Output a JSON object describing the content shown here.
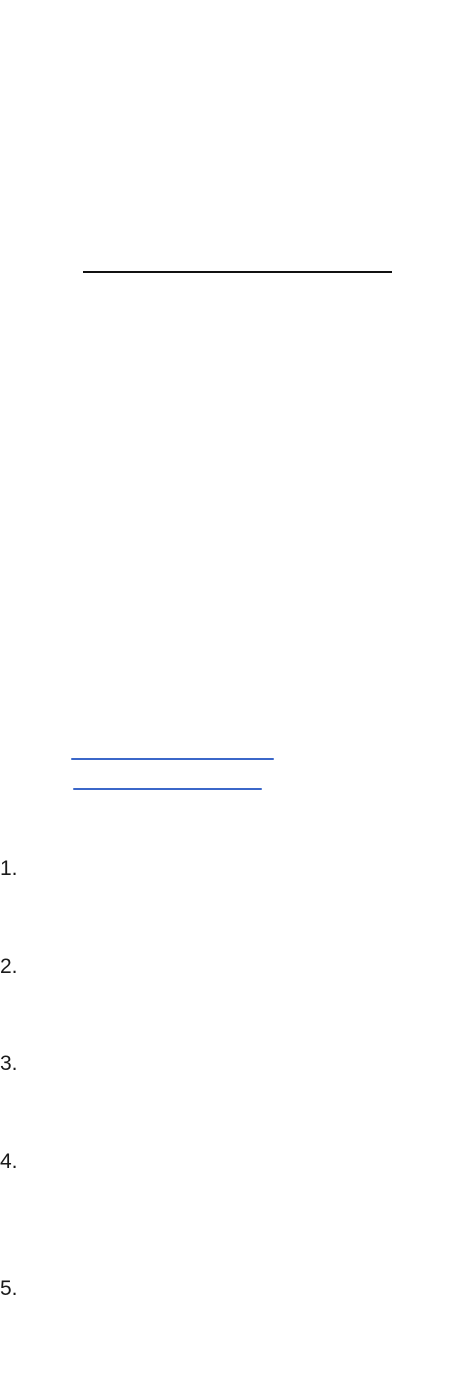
{
  "document": {
    "list": {
      "markers": [
        "1.",
        "2.",
        "3.",
        "4.",
        "5."
      ]
    },
    "colors": {
      "text": "#1a1a1a",
      "rule": "#111111",
      "link": "#3b67c9",
      "background": "#ffffff"
    }
  }
}
